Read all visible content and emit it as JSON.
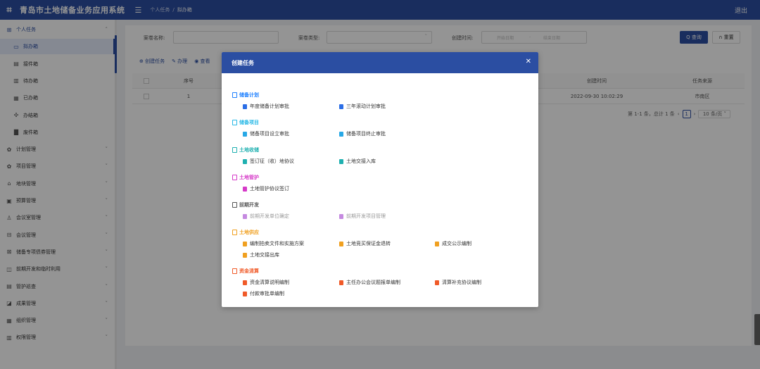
{
  "header": {
    "logo_icon": "grid-logo-icon",
    "title": "青岛市土地储备业务应用系统",
    "menu_toggle_icon": "menu-fold-icon",
    "breadcrumb": [
      "个人任务",
      "拟办箱"
    ],
    "breadcrumb_sep": "/",
    "logout": "退出"
  },
  "sidebar": {
    "items": [
      {
        "label": "个人任务",
        "icon": "grid-icon",
        "glyph": "⊞",
        "arrow": "˄",
        "type": "group"
      },
      {
        "label": "拟办箱",
        "icon": "folder-open-icon",
        "glyph": "▭",
        "type": "sub",
        "active": true
      },
      {
        "label": "接件箱",
        "icon": "calendar-icon",
        "glyph": "▤",
        "type": "sub"
      },
      {
        "label": "待办箱",
        "icon": "list-icon",
        "glyph": "▥",
        "type": "sub"
      },
      {
        "label": "已办箱",
        "icon": "done-list-icon",
        "glyph": "▦",
        "type": "sub"
      },
      {
        "label": "办结箱",
        "icon": "finish-icon",
        "glyph": "✣",
        "type": "sub"
      },
      {
        "label": "废件箱",
        "icon": "trash-box-icon",
        "glyph": "▇",
        "type": "sub"
      },
      {
        "label": "计划管理",
        "icon": "plan-gear-icon",
        "glyph": "✿",
        "arrow": "˅"
      },
      {
        "label": "项目管理",
        "icon": "project-gear-icon",
        "glyph": "✿",
        "arrow": "˅"
      },
      {
        "label": "地块管理",
        "icon": "parcel-icon",
        "glyph": "⌂",
        "arrow": "˅"
      },
      {
        "label": "预算管理",
        "icon": "budget-icon",
        "glyph": "▣",
        "arrow": "˅"
      },
      {
        "label": "会议室管理",
        "icon": "user-icon",
        "glyph": "♙",
        "arrow": "˅"
      },
      {
        "label": "会议管理",
        "icon": "meeting-icon",
        "glyph": "⊟",
        "arrow": "˅"
      },
      {
        "label": "储备专项债券管理",
        "icon": "bond-icon",
        "glyph": "⊠",
        "arrow": "˅"
      },
      {
        "label": "前期开发和临时利用",
        "icon": "develop-icon",
        "glyph": "◫",
        "arrow": "˅"
      },
      {
        "label": "管护巡查",
        "icon": "inspect-icon",
        "glyph": "▤",
        "arrow": "˅"
      },
      {
        "label": "成果管理",
        "icon": "result-icon",
        "glyph": "◪",
        "arrow": "˅"
      },
      {
        "label": "组织管理",
        "icon": "org-icon",
        "glyph": "▦",
        "arrow": "˅"
      },
      {
        "label": "权限管理",
        "icon": "permission-icon",
        "glyph": "▥",
        "arrow": "˅"
      }
    ]
  },
  "search": {
    "case_name_label": "案卷名称:",
    "case_type_label": "案卷类型:",
    "created_label": "创建时间:",
    "date_start_ph": "开始日期",
    "date_sep": "-",
    "date_end_ph": "结束日期",
    "query_btn": "Q 查询",
    "reset_btn": "∩ 重置"
  },
  "toolbar": {
    "create_task": "⊕ 创建任务",
    "edit": "✎ 办理",
    "view": "◉ 查看"
  },
  "table": {
    "headers": [
      "序号",
      "创建时间",
      "任务来源"
    ],
    "rows": [
      {
        "index": "1",
        "created": "2022-09-30 10:02:29",
        "source": "市南区"
      }
    ]
  },
  "pager": {
    "summary": "第 1-1 条，总计 1 条",
    "prev": "‹",
    "page": "1",
    "next": "›",
    "size": "10 条/页 ˅"
  },
  "modal": {
    "title": "创建任务",
    "close_icon": "close-icon",
    "sections": [
      {
        "label": "储备计划",
        "color": "#1e80ff",
        "items": [
          "年度储备计划审批",
          "三年滚动计划审批"
        ]
      },
      {
        "label": "储备项目",
        "color": "#27b8e6",
        "items": [
          "储备项目设立审批",
          "储备项目终止审批"
        ]
      },
      {
        "label": "土地收储",
        "color": "#1fb0b0",
        "items": [
          "签订征（收）地协议",
          "土地交接入库"
        ]
      },
      {
        "label": "土地管护",
        "color": "#d63ac8",
        "items": [
          "土地管护协议签订"
        ]
      },
      {
        "label": "前期开发",
        "color": "#555555",
        "items": [
          "前期开发单位确定",
          "前期开发项目管理"
        ]
      },
      {
        "label": "土地供应",
        "color": "#f0a020",
        "items": [
          "编制拍卖文件和实施方案",
          "土地竞买保证金退转",
          "成交公示编制",
          "土地交接出库"
        ]
      },
      {
        "label": "资金清算",
        "color": "#f05a28",
        "items": [
          "资金清算说明编制",
          "主任办公会议题报单编制",
          "清算补充协议编制",
          "付款审批单编制"
        ]
      }
    ],
    "item_icon_colors": [
      "#2b6ee6",
      "#27a8e6",
      "#1fb0b0",
      "#d63ac8",
      "#c58ae0",
      "#f0a020",
      "#f05a28"
    ]
  }
}
